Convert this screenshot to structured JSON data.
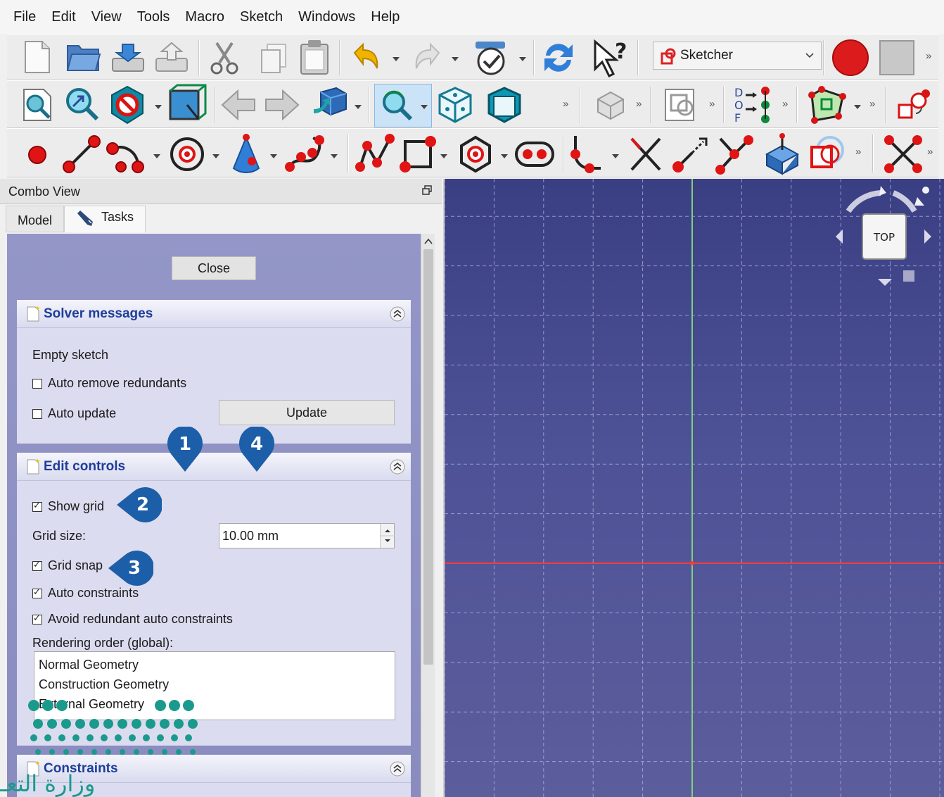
{
  "menu": [
    "File",
    "Edit",
    "View",
    "Tools",
    "Macro",
    "Sketch",
    "Windows",
    "Help"
  ],
  "workbench": {
    "selected": "Sketcher"
  },
  "toolbars": {
    "row1": [
      "new-file-icon",
      "open-file-icon",
      "import-icon",
      "export-icon",
      "cut-icon",
      "copy-icon",
      "paste-icon",
      "undo-icon",
      "redo-icon",
      "refresh-recompute-icon",
      "refresh-icon",
      "whats-this-icon",
      "record-macro-icon",
      "stop-macro-icon"
    ],
    "row2": [
      "fit-all-icon",
      "fit-selection-icon",
      "draw-style-icon",
      "bounding-box-icon",
      "back-icon",
      "forward-icon",
      "workbench-3d-icon",
      "sync-view-icon",
      "isometric-view-icon",
      "front-view-icon",
      "new-sketch-icon",
      "view-section-icon",
      "dof-icon",
      "validate-sketch-icon",
      "constraint-icon"
    ],
    "row3": [
      "point-icon",
      "line-icon",
      "arc-icon",
      "circle-icon",
      "conic-icon",
      "bspline-icon",
      "polyline-icon",
      "rectangle-icon",
      "polygon-icon",
      "slot-icon",
      "fillet-icon",
      "trim-icon",
      "extend-icon",
      "split-icon",
      "external-geometry-icon",
      "carbon-copy-icon",
      "construction-icon"
    ]
  },
  "combo": {
    "title": "Combo View",
    "tabs": [
      "Model",
      "Tasks"
    ],
    "close_label": "Close",
    "solver": {
      "title": "Solver messages",
      "status": "Empty sketch",
      "auto_remove": "Auto remove redundants",
      "auto_update": "Auto update",
      "update_label": "Update"
    },
    "edit_controls": {
      "title": "Edit controls",
      "show_grid": "Show grid",
      "grid_size_label": "Grid size:",
      "grid_size_value": "10.00 mm",
      "grid_snap": "Grid snap",
      "auto_constraints": "Auto constraints",
      "avoid_redundant": "Avoid redundant auto constraints",
      "rendering_order_label": "Rendering order (global):",
      "rendering_order": [
        "Normal Geometry",
        "Construction Geometry",
        "External Geometry"
      ]
    },
    "constraints": {
      "title": "Constraints"
    }
  },
  "navcube": {
    "face": "TOP"
  },
  "callouts": [
    "1",
    "2",
    "3",
    "4"
  ],
  "watermark_text": "وزارة التعـ"
}
